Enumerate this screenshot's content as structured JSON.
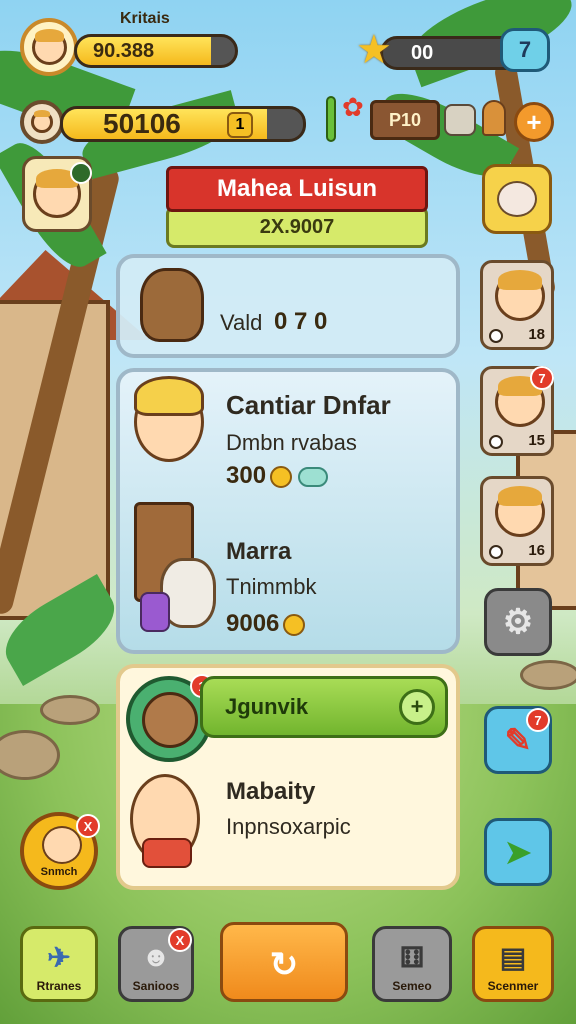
{
  "header": {
    "player_name": "Kritais",
    "top_bar_value": "90.388",
    "top_bar_fill": 0.85,
    "second_bar_value": "50106",
    "second_bar_level": "1",
    "second_bar_fill": 0.85,
    "star_value": "00",
    "star_button_value": "7",
    "wood_sign": "P10"
  },
  "banner": {
    "title": "Mahea Luisun",
    "subtitle": "2X.9007"
  },
  "panel_top": {
    "label": "Vald",
    "value": "0 7 0"
  },
  "panel_middle": {
    "char1_title": "Cantiar Dnfar",
    "char1_subtitle": "Dmbn rvabas",
    "char1_value": "300",
    "char2_title": "Marra",
    "char2_subtitle": "Tnimmbk",
    "char2_value": "9006"
  },
  "panel_bottom": {
    "action_label": "Jgunvik",
    "action_plus": "+",
    "avatar_badge": "1",
    "char_title": "Mabaity",
    "char_subtitle": "Inpnsoxarpic"
  },
  "side_cards": [
    {
      "value": "18"
    },
    {
      "value": "15",
      "badge": "7"
    },
    {
      "value": "16"
    }
  ],
  "left_button_label": "Snmch",
  "left_button_badge": "X",
  "right_buttons": {
    "edit_badge": "7"
  },
  "bottom_nav": [
    {
      "label": "Rtranes"
    },
    {
      "label": "Sanioos",
      "badge": "X"
    },
    {
      "label": ""
    },
    {
      "label": "Semeo"
    },
    {
      "label": "Scenmer"
    }
  ],
  "colors": {
    "accent_orange": "#f39a2c",
    "accent_green": "#72b52e",
    "banner_red": "#d8342b",
    "sky": "#8fd3f2"
  }
}
